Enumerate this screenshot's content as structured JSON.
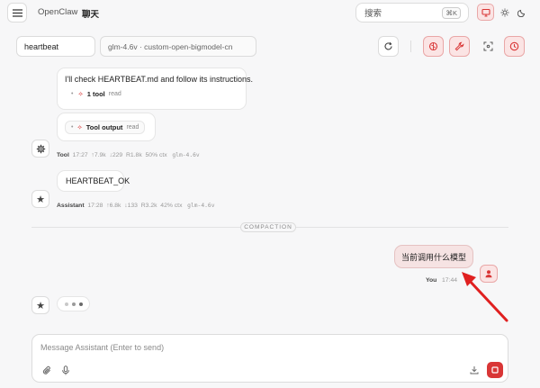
{
  "breadcrumb": {
    "app": "OpenClaw",
    "sep": "›",
    "current": "聊天"
  },
  "search": {
    "label": "搜索",
    "shortcut": "⌘K"
  },
  "session": {
    "key": "heartbeat",
    "model": "glm-4.6v · custom-open-bigmodel-cn"
  },
  "messages": {
    "assistant_intro": "I'll check HEARTBEAT.md and follow its instructions.",
    "tool_count": "1 tool",
    "tool_read": "read",
    "tool_output_label": "Tool output",
    "tool_output_read": "read",
    "tool_meta": {
      "role": "Tool",
      "time": "17:27",
      "up": "↑7.9k",
      "down": "↓229",
      "r": "R1.8k",
      "ctx": "50% ctx",
      "model": "glm-4.6v"
    },
    "heartbeat_ok": "HEARTBEAT_OK",
    "assistant_meta": {
      "role": "Assistant",
      "time": "17:28",
      "up": "↑6.8k",
      "down": "↓133",
      "r": "R3.2k",
      "ctx": "42% ctx",
      "model": "glm-4.6v"
    },
    "compaction": "COMPACTION",
    "user_message": "当前调用什么模型",
    "user_meta": {
      "role": "You",
      "time": "17:44"
    }
  },
  "composer": {
    "placeholder": "Message Assistant (Enter to send)"
  },
  "colors": {
    "accent": "#d93636",
    "accent_bg": "#fbe4e4",
    "annotation_arrow": "#e02020"
  },
  "icons": [
    "menu-icon",
    "monitor-icon",
    "sun-icon",
    "moon-icon",
    "refresh-icon",
    "brain-icon",
    "wrench-icon",
    "focus-icon",
    "clock-icon",
    "gear-icon",
    "sparkle-icon",
    "star-icon",
    "user-icon",
    "paperclip-icon",
    "mic-icon",
    "download-icon",
    "stop-icon"
  ]
}
